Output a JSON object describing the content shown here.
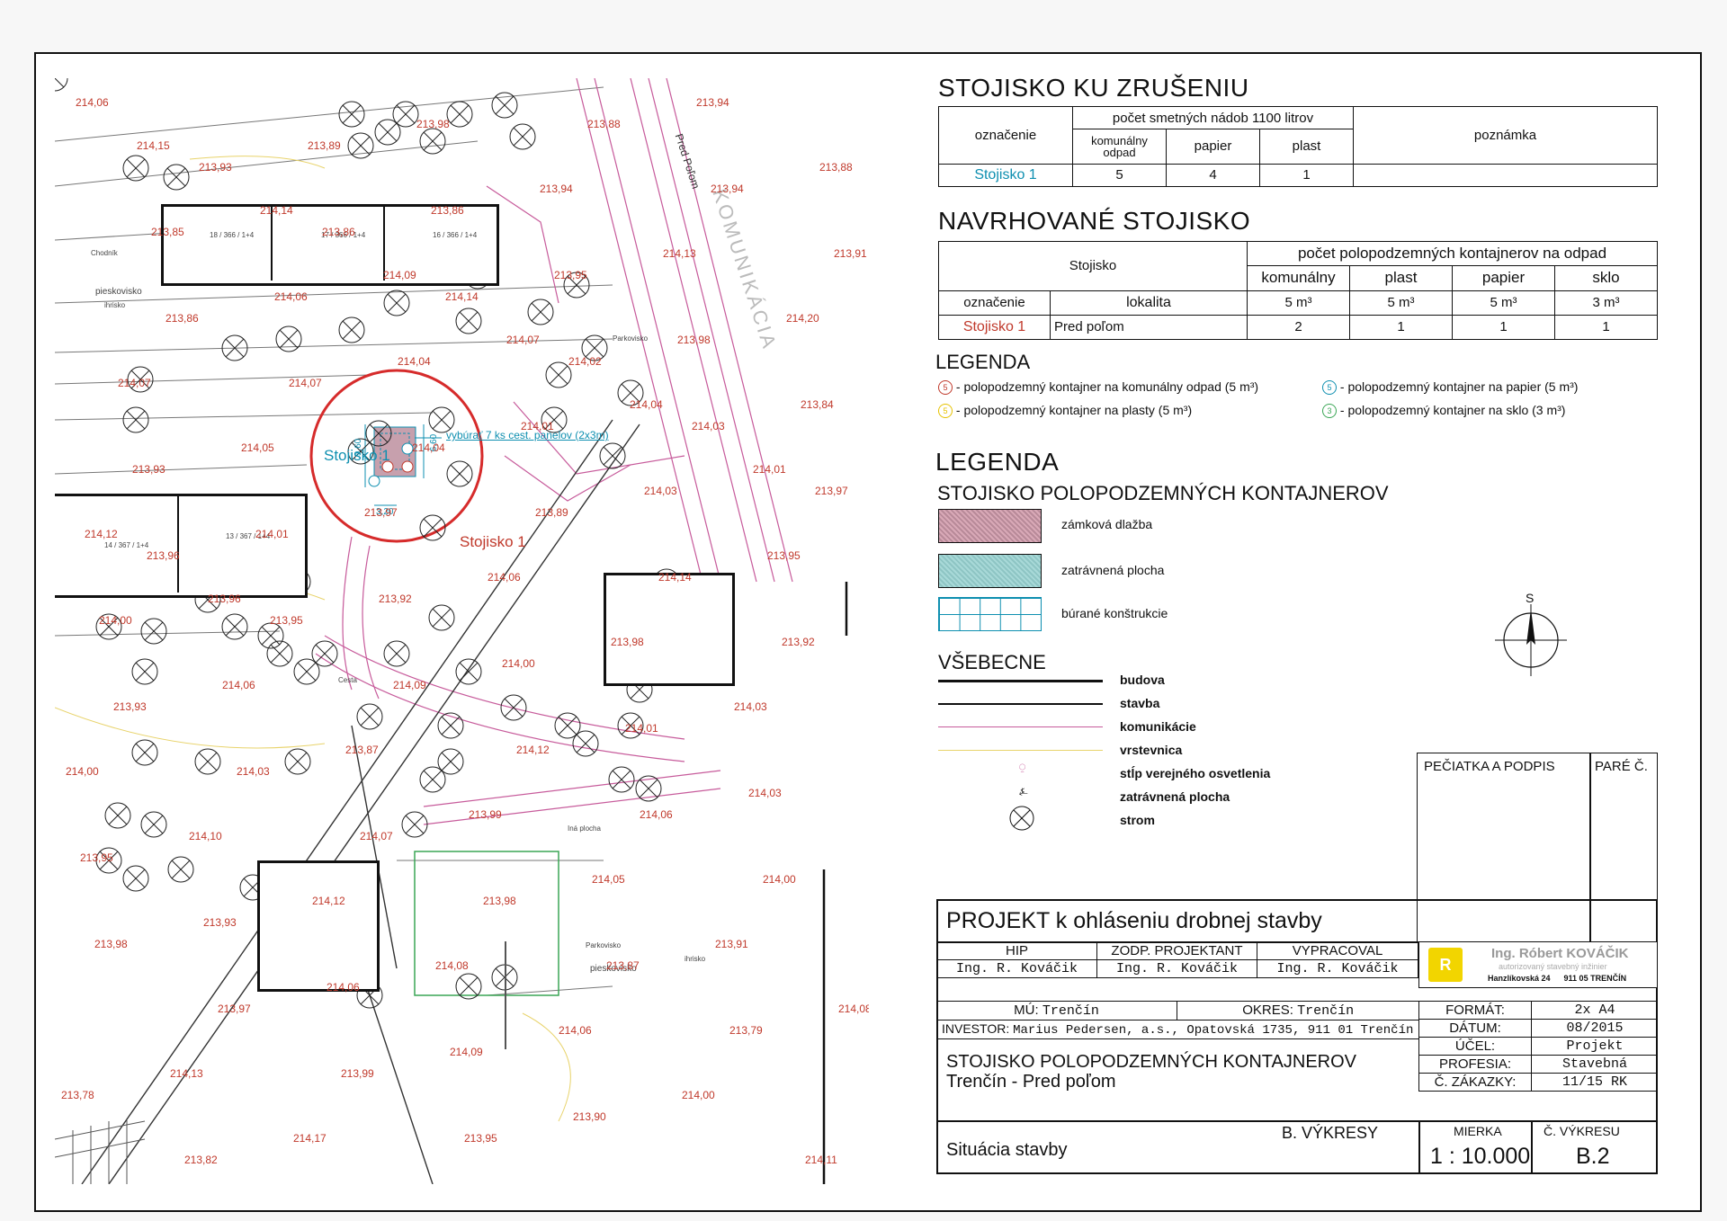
{
  "section1": {
    "title": "STOJISKO KU ZRUŠENIU",
    "header_count": "počet smetných nádob 1100 litrov",
    "col_oznacenie": "označenie",
    "col_komunalny": "komunálny odpad",
    "col_papier": "papier",
    "col_plast": "plast",
    "col_poznamka": "poznámka",
    "row": {
      "name": "Stojisko 1",
      "komunalny": "5",
      "papier": "4",
      "plast": "1"
    }
  },
  "section2": {
    "title": "NAVRHOVANÉ STOJISKO",
    "header_stojisko": "Stojisko",
    "header_count": "počet polopodzemných kontajnerov na odpad",
    "col_oznacenie": "označenie",
    "col_lokalita": "lokalita",
    "col_komunalny": "komunálny",
    "col_plast": "plast",
    "col_papier": "papier",
    "col_sklo": "sklo",
    "vol_komunalny": "5 m³",
    "vol_plast": "5 m³",
    "vol_papier": "5 m³",
    "vol_sklo": "3 m³",
    "row": {
      "name": "Stojisko 1",
      "lokalita": "Pred poľom",
      "komunalny": "2",
      "plast": "1",
      "papier": "1",
      "sklo": "1"
    }
  },
  "legend1": {
    "title": "LEGENDA",
    "items": [
      {
        "sym": "5",
        "text": "- polopodzemný kontajner na komunálny odpad (5 m³)",
        "color": "#c0392b"
      },
      {
        "sym": "5",
        "text": "- polopodzemný kontajner na papier (5 m³)",
        "color": "#0e8fb0"
      },
      {
        "sym": "5",
        "text": "- polopodzemný kontajner na plasty (5 m³)",
        "color": "#e6c200"
      },
      {
        "sym": "3",
        "text": "- polopodzemný kontajner na sklo (3 m³)",
        "color": "#3aa655"
      }
    ]
  },
  "legend2": {
    "title": "LEGENDA",
    "subtitle": "STOJISKO POLOPODZEMNÝCH KONTAJNEROV",
    "items": [
      "zámková dlažba",
      "zatrávnená plocha",
      "búrané konštrukcie"
    ]
  },
  "vseobecne": {
    "title": "VŠEBECNE",
    "items": [
      "budova",
      "stavba",
      "komunikácie",
      "vrstevnica",
      "stĺp verejného osvetlenia",
      "zatrávnená plocha",
      "strom"
    ]
  },
  "north": "S",
  "stamp": {
    "pečiatka": "PEČIATKA A PODPIS",
    "pare": "PARÉ Č."
  },
  "titleblock": {
    "projekt": "PROJEKT k ohláseniu drobnej stavby",
    "hip_label": "HIP",
    "zodp_label": "ZODP. PROJEKTANT",
    "vypracoval_label": "VYPRACOVAL",
    "hip": "Ing. R. Kováčik",
    "zodp": "Ing. R. Kováčik",
    "vypracoval": "Ing. R. Kováčik",
    "logo_name": "Ing. Róbert KOVÁČIK",
    "logo_sub": "autorizovaný stavebný inžinier",
    "logo_addr": "Hanzlíkovská 24      911 05 TRENČÍN",
    "mu_label": "MÚ:",
    "mu": "Trenčín",
    "okres_label": "OKRES:",
    "okres": "Trenčín",
    "investor_label": "INVESTOR:",
    "investor": "Marius Pedersen, a.s., Opatovská 1735, 911 01 Trenčín",
    "nazov1": "STOJISKO POLOPODZEMNÝCH KONTAJNEROV",
    "nazov2": "Trenčín - Pred poľom",
    "format_label": "FORMÁT:",
    "format": "2x A4",
    "datum_label": "DÁTUM:",
    "datum": "08/2015",
    "ucel_label": "ÚČEL:",
    "ucel": "Projekt",
    "profesia_label": "PROFESIA:",
    "profesia": "Stavebná",
    "zakazka_label": "Č. ZÁKAZKY:",
    "zakazka": "11/15 RK",
    "vykresy": "B. VÝKRESY",
    "situacia": "Situácia stavby",
    "mierka_label": "MIERKA",
    "mierka": "1 : 10.000",
    "cislo_label": "Č. VÝKRESU",
    "cislo": "B.2"
  },
  "map": {
    "stojisko_label_cyan": "Stojisko 1",
    "stojisko_label_red": "Stojisko 1",
    "note": "vybúrať 7 ks cest. panelov (2x3m)",
    "dim1": "9,60",
    "dim2": "6,60",
    "dim3": "3,20",
    "street1": "Pred Poľom",
    "street2": "KOMUNIKÁCIA",
    "heights": [
      "214,06",
      "213,93",
      "213,86",
      "214,14",
      "214,02",
      "214,03",
      "213,97",
      "213,96",
      "213,95",
      "214,09",
      "214,12",
      "214,06",
      "214,00",
      "213,98",
      "213,97",
      "213,99",
      "213,95",
      "213,88",
      "213,94",
      "213,91",
      "213,86",
      "214,07",
      "214,04",
      "213,89",
      "214,14",
      "213,92",
      "213,93",
      "214,03",
      "214,07",
      "213,98",
      "213,87",
      "213,79",
      "213,78",
      "213,82",
      "213,89",
      "213,86",
      "213,95",
      "213,98",
      "213,84",
      "213,93",
      "214,01",
      "213,92",
      "214,00",
      "214,01",
      "214,03",
      "213,95",
      "213,93",
      "214,06",
      "214,09",
      "213,90",
      "213,94",
      "213,88",
      "213,85",
      "214,06",
      "214,04",
      "214,01",
      "214,03",
      "213,95",
      "214,00",
      "214,06",
      "213,87",
      "213,99",
      "214,05",
      "213,91",
      "214,08",
      "214,13",
      "214,17",
      "213,98",
      "213,94",
      "214,13",
      "214,20",
      "214,07",
      "214,05",
      "213,97",
      "214,06",
      "213,98",
      "214,03",
      "214,00",
      "214,10",
      "214,12",
      "214,08",
      "214,06",
      "214,00",
      "214,11",
      "214,15",
      "214,14",
      "214,09",
      "214,07",
      "214,04",
      "214,01",
      "214,12",
      "213,96"
    ],
    "blocks": [
      {
        "id": "18 / 366 / 1+4"
      },
      {
        "id": "17 / 366 / 1+4"
      },
      {
        "id": "16 / 366 / 1+4"
      },
      {
        "id": "14 / 367 / 1+4"
      },
      {
        "id": "13 / 367 / 1+4"
      }
    ],
    "places": [
      "Chodník",
      "pieskovisko",
      "ihrisko",
      "Parkovisko",
      "Iná plocha",
      "Cesta",
      "Parkovisko",
      "pieskovisko",
      "ihrisko"
    ]
  }
}
